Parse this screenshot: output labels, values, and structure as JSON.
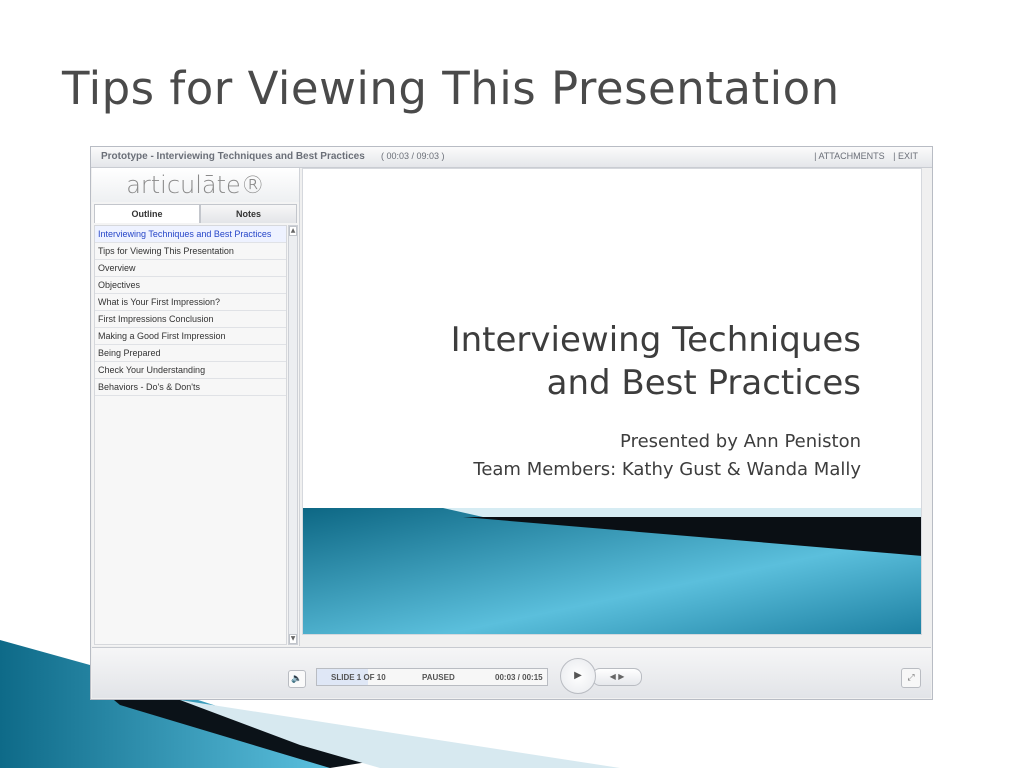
{
  "page": {
    "title": "Tips for Viewing This Presentation"
  },
  "player": {
    "course_title": "Prototype - Interviewing Techniques and Best Practices",
    "course_time": "( 00:03 / 09:03 )",
    "top_buttons": [
      "| ATTACHMENTS",
      "| EXIT"
    ],
    "logo": "articulāte®",
    "tabs": [
      "Outline",
      "Notes"
    ],
    "outline_items": [
      "Interviewing Techniques and Best Practices",
      "Tips for Viewing This Presentation",
      "Overview",
      "Objectives",
      "What is Your First Impression?",
      "First Impressions Conclusion",
      "Making a Good First Impression",
      "Being Prepared",
      "Check Your Understanding",
      "Behaviors - Do's & Don'ts"
    ],
    "selected_index": 0
  },
  "slide": {
    "title_line1": "Interviewing Techniques",
    "title_line2": "and Best Practices",
    "presenter": "Presented by Ann Peniston",
    "team": "Team Members: Kathy Gust & Wanda Mally"
  },
  "controls": {
    "volume_icon": "volume-icon",
    "slide_counter": "SLIDE 1 OF 10",
    "status": "PAUSED",
    "time": "00:03 / 00:15",
    "seek_progress": 0.22,
    "play_symbol": "▶",
    "prevnext_symbols": "◀ ▶",
    "fullscreen_symbol": "⤢"
  },
  "colors": {
    "band_dark": "#0d6784",
    "band_light": "#5bbfdc",
    "accent_link": "#2646c8"
  }
}
